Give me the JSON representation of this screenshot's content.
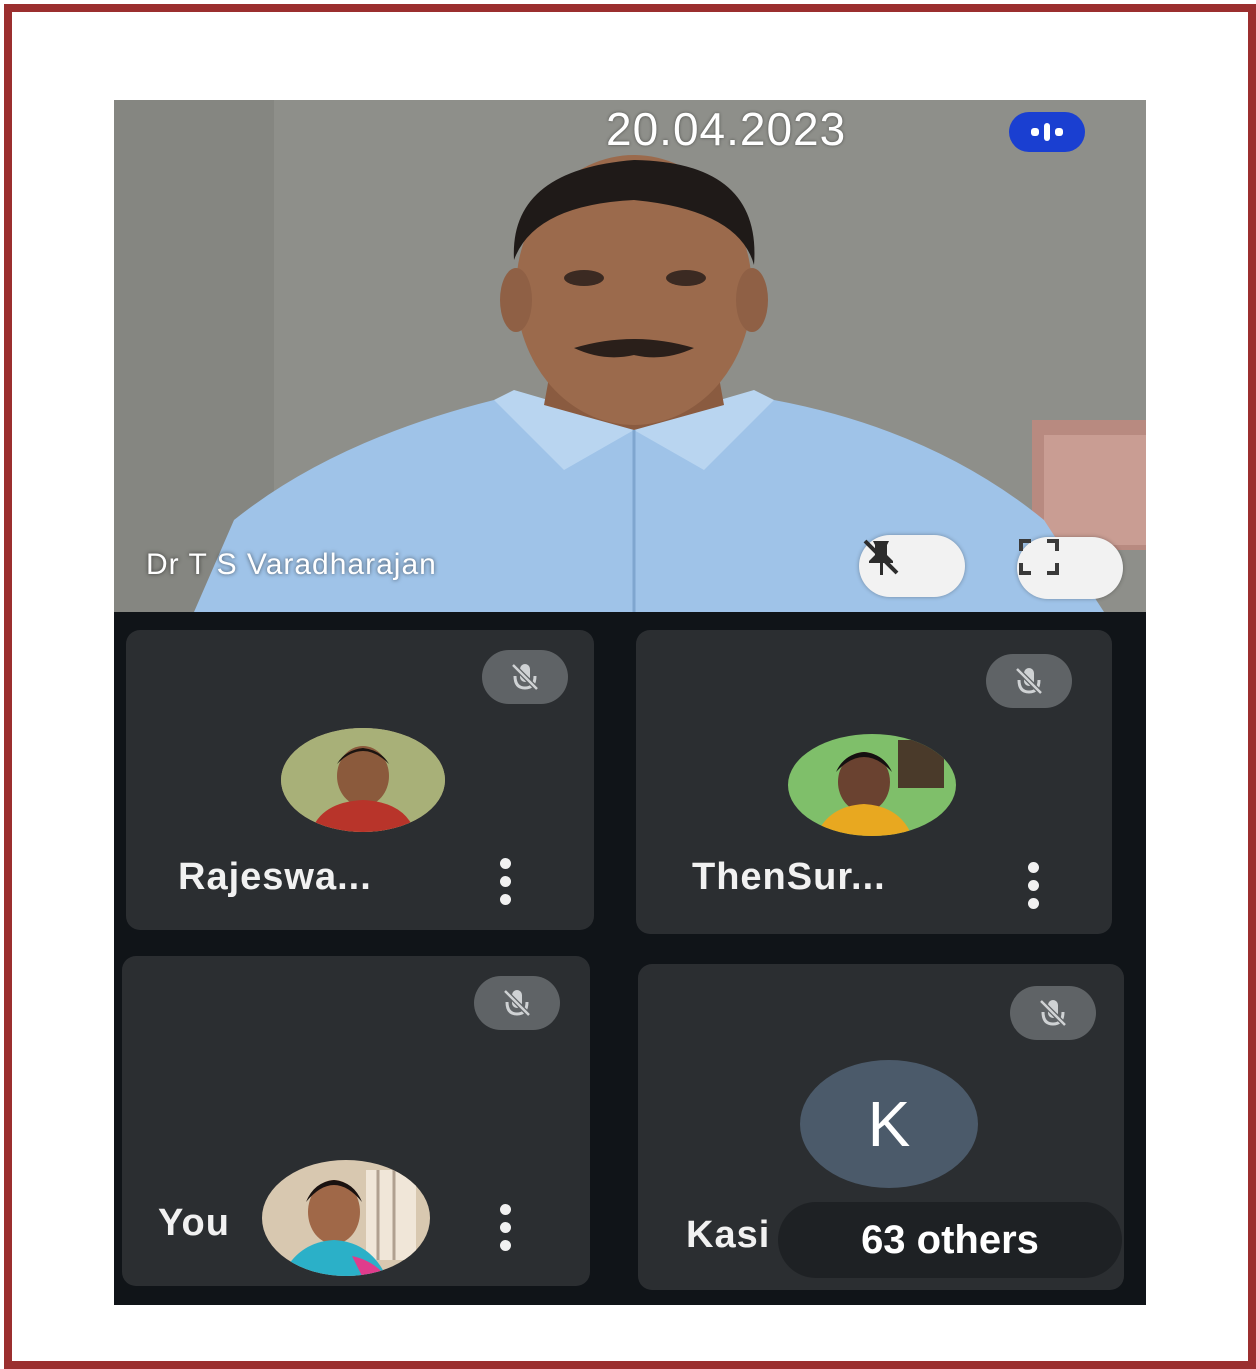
{
  "meeting": {
    "date": "20.04.2023",
    "rec_indicator_icon": "record-indicator-icon"
  },
  "speaker": {
    "name": "Dr T S Varadharajan",
    "unpin_icon": "unpin-icon",
    "fullscreen_icon": "fullscreen-icon"
  },
  "participants": [
    {
      "name": "Rajeswa...",
      "mic": "muted"
    },
    {
      "name": "ThenSur...",
      "mic": "muted"
    },
    {
      "name": "You",
      "mic": "muted"
    },
    {
      "name": "Kasi",
      "initial": "K",
      "mic": "muted"
    }
  ],
  "others": {
    "label": "63 others"
  },
  "colors": {
    "frame": "#9b2f2f",
    "tile_bg": "#2b2e31",
    "rec_badge": "#1a3fd1",
    "k_avatar": "#4b5a6a"
  }
}
